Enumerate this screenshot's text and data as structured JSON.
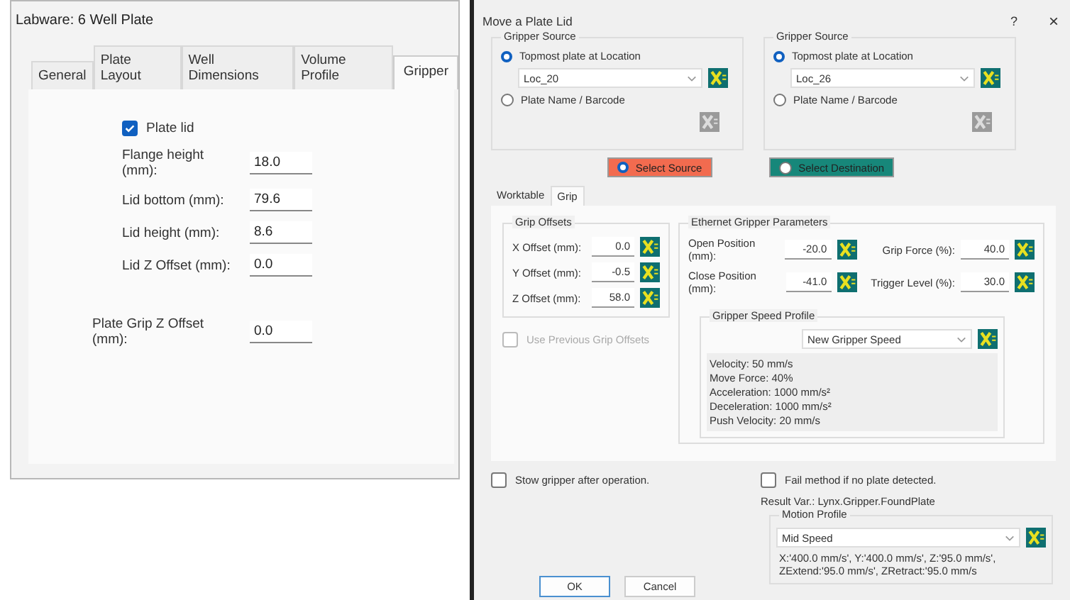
{
  "labware": {
    "title": "Labware: 6 Well Plate",
    "tabs": [
      {
        "label": "General",
        "selected": false
      },
      {
        "label": "Plate Layout",
        "selected": false
      },
      {
        "label": "Well Dimensions",
        "selected": false
      },
      {
        "label": "Volume Profile",
        "selected": false
      },
      {
        "label": "Gripper",
        "selected": true
      }
    ],
    "plate_lid": {
      "label": "Plate lid",
      "checked": true
    },
    "fields": [
      {
        "label": "Flange height (mm):",
        "value": "18.0"
      },
      {
        "label": "Lid bottom (mm):",
        "value": "79.6"
      },
      {
        "label": "Lid height (mm):",
        "value": "8.6"
      },
      {
        "label": "Lid Z Offset (mm):",
        "value": "0.0"
      }
    ],
    "grip_field": {
      "label": "Plate Grip Z Offset (mm):",
      "value": "0.0"
    }
  },
  "move": {
    "title": "Move a Plate Lid",
    "help": "?",
    "close": "×",
    "sources": [
      {
        "title": "Gripper Source",
        "options": [
          {
            "label": "Topmost plate at Location",
            "selected": true
          },
          {
            "label": "Plate Name / Barcode",
            "selected": false
          }
        ],
        "location": "Loc_20"
      },
      {
        "title": "Gripper Source",
        "options": [
          {
            "label": "Topmost plate at Location",
            "selected": true
          },
          {
            "label": "Plate Name / Barcode",
            "selected": false
          }
        ],
        "location": "Loc_26"
      }
    ],
    "mode_buttons": [
      {
        "label": "Select Source",
        "selected": true,
        "color": "#f26b4f"
      },
      {
        "label": "Select Destination",
        "selected": false,
        "color": "#17877a"
      }
    ],
    "tabs": [
      {
        "label": "Worktable",
        "selected": false
      },
      {
        "label": "Grip",
        "selected": true
      }
    ],
    "grip_offsets": {
      "title": "Grip Offsets",
      "fields": [
        {
          "label": "X Offset (mm):",
          "value": "0.0"
        },
        {
          "label": "Y Offset (mm):",
          "value": "-0.5"
        },
        {
          "label": "Z Offset (mm):",
          "value": "58.0"
        }
      ]
    },
    "use_previous": {
      "label": "Use Previous Grip Offsets",
      "checked": false,
      "disabled": true
    },
    "ethernet": {
      "title": "Ethernet Gripper Parameters",
      "fields": [
        {
          "label": "Open Position (mm):",
          "value": "-20.0"
        },
        {
          "label": "Grip Force (%):",
          "value": "40.0"
        },
        {
          "label": "Close Position (mm):",
          "value": "-41.0"
        },
        {
          "label": "Trigger Level (%):",
          "value": "30.0"
        }
      ]
    },
    "speed_profile": {
      "title": "Gripper Speed Profile",
      "value": "New Gripper Speed",
      "details": [
        "Velocity: 50 mm/s",
        "Move Force: 40%",
        "Acceleration: 1000  mm/s²",
        "Deceleration: 1000  mm/s²",
        "Push Velocity: 20 mm/s"
      ]
    },
    "stow": {
      "label": "Stow gripper after operation.",
      "checked": false
    },
    "fail": {
      "label": "Fail method if no plate detected.",
      "checked": false
    },
    "result_var": "Result Var.: Lynx.Gripper.FoundPlate",
    "motion_profile": {
      "title": "Motion Profile",
      "value": "Mid Speed",
      "details": [
        "X:'400.0 mm/s', Y:'400.0 mm/s', Z:'95.0 mm/s',",
        "ZExtend:'95.0 mm/s', ZRetract:'95.0 mm/s"
      ]
    },
    "buttons": [
      "OK",
      "Cancel"
    ]
  }
}
